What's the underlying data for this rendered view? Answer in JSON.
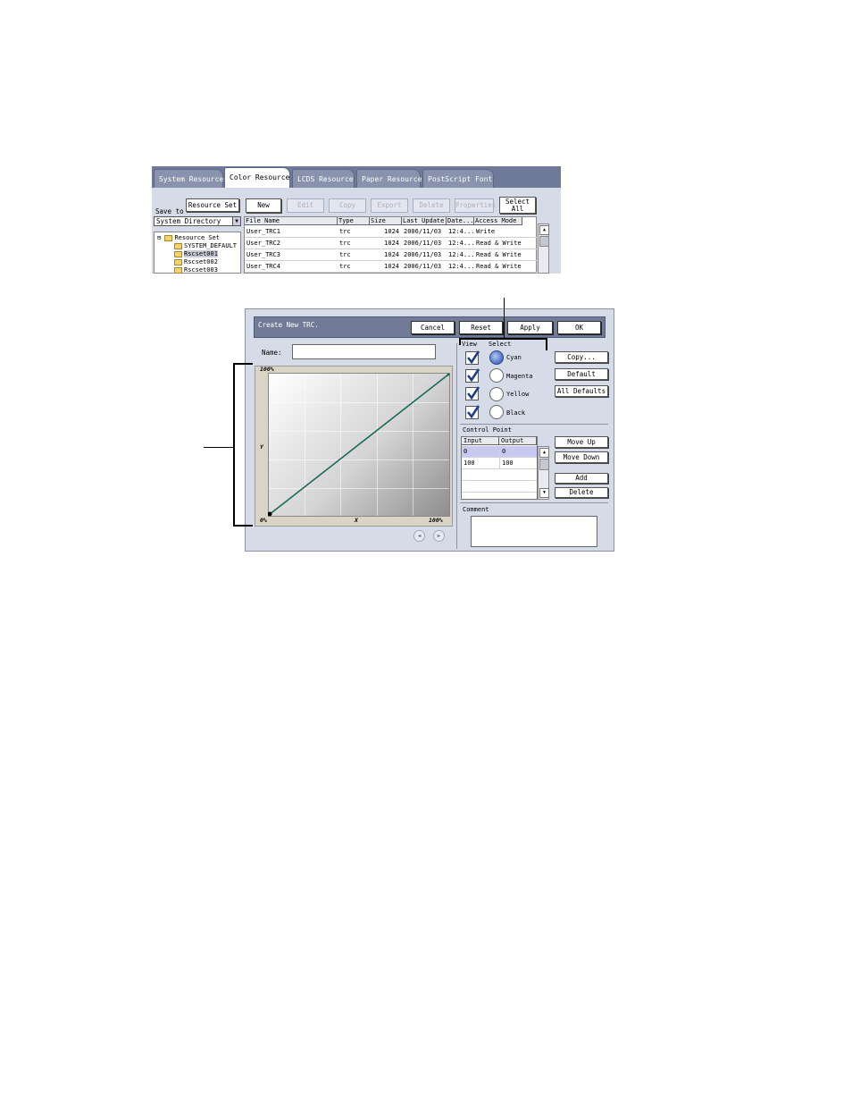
{
  "resource_manager": {
    "tabs": [
      "System Resource",
      "Color Resource",
      "LCDS Resource",
      "Paper Resource",
      "PostScript Font"
    ],
    "active_tab": "Color Resource",
    "save_to_label": "Save to",
    "resource_set_button": "Resource Set",
    "toolbar": {
      "new": "New",
      "edit": "Edit",
      "copy": "Copy",
      "export": "Export",
      "delete": "Delete",
      "properties": "Properties",
      "select_all_line1": "Select",
      "select_all_line2": "All"
    },
    "directory_select": "System Directory",
    "tree": {
      "root": "Resource Set",
      "items": [
        "SYSTEM_DEFAULT",
        "Rscset001",
        "Rscset002",
        "Rscset003"
      ],
      "selected": "Rscset001"
    },
    "table": {
      "headers": [
        "File Name",
        "Type",
        "Size",
        "Last Update",
        "Date...",
        "Access Mode"
      ],
      "rows": [
        {
          "name": "User_TRC1",
          "type": "trc",
          "size": "1024",
          "date": "2006/11/03",
          "time": "12:4...",
          "access": "Write"
        },
        {
          "name": "User_TRC2",
          "type": "trc",
          "size": "1024",
          "date": "2006/11/03",
          "time": "12:4...",
          "access": "Read & Write"
        },
        {
          "name": "User_TRC3",
          "type": "trc",
          "size": "1024",
          "date": "2006/11/03",
          "time": "12:4...",
          "access": "Read & Write"
        },
        {
          "name": "User_TRC4",
          "type": "trc",
          "size": "1024",
          "date": "2006/11/03",
          "time": "12:4...",
          "access": "Read & Write"
        }
      ]
    }
  },
  "trc_dialog": {
    "title": "Create New TRC.",
    "buttons": {
      "cancel": "Cancel",
      "reset": "Reset",
      "apply": "Apply",
      "ok": "OK"
    },
    "name_label": "Name:",
    "name_value": "",
    "graph": {
      "y_max": "100%",
      "y_label": "Y",
      "x_origin": "0%",
      "x_label": "X",
      "x_max": "100%"
    },
    "view_label": "View",
    "select_label": "Select",
    "colors": [
      "Cyan",
      "Magenta",
      "Yellow",
      "Black"
    ],
    "selected_color": "Cyan",
    "side_buttons": {
      "copy": "Copy...",
      "default": "Default",
      "all_defaults": "All Defaults"
    },
    "control_point_label": "Control Point",
    "control_point_headers": [
      "Input",
      "Output"
    ],
    "control_points": [
      {
        "input": "0",
        "output": "0"
      },
      {
        "input": "100",
        "output": "100"
      }
    ],
    "cp_buttons": {
      "move_up": "Move Up",
      "move_down": "Move Down",
      "add": "Add",
      "delete": "Delete"
    },
    "comment_label": "Comment",
    "comment_value": ""
  },
  "colors": {
    "titlebar": "#717b98",
    "panel": "#d6dbe8",
    "curve": "#1a6a5a",
    "selected_row": "#c9c8f0"
  }
}
